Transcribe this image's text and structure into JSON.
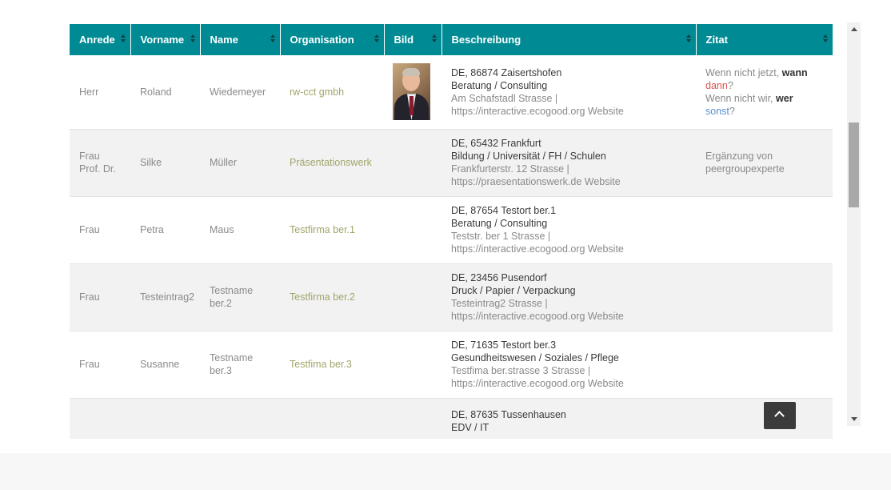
{
  "table": {
    "headers": [
      "Anrede",
      "Vorname",
      "Name",
      "Organisation",
      "Bild",
      "Beschreibung",
      "Zitat"
    ],
    "rows": [
      {
        "anrede": "Herr",
        "vorname": "Roland",
        "name": "Wiedemeyer",
        "organisation": "rw-cct gmbh",
        "has_photo": true,
        "desc_line1": "DE, 86874 Zaisertshofen",
        "desc_line2": "Beratung / Consulting",
        "desc_line3": "Am Schafstadl Strasse |",
        "desc_line4": "https://interactive.ecogood.org Website",
        "zitat": {
          "p1": "Wenn nicht jetzt, ",
          "p2": "wann",
          "p3": "dann",
          "p4": "?",
          "p5": "Wenn nicht wir, ",
          "p6": "wer",
          "p7": "sonst",
          "p8": "?"
        }
      },
      {
        "anrede_l1": "Frau",
        "anrede_l2": "Prof. Dr.",
        "vorname": "Silke",
        "name": "Müller",
        "organisation": "Präsentationswerk",
        "desc_line1": "DE, 65432 Frankfurt",
        "desc_line2": "Bildung / Universität / FH / Schulen",
        "desc_line3": "Frankfurterstr. 12 Strasse |",
        "desc_line4": "https://praesentationswerk.de Website",
        "zitat_l1": "Ergänzung von",
        "zitat_l2": "peergroupexperte"
      },
      {
        "anrede": "Frau",
        "vorname": "Petra",
        "name": "Maus",
        "organisation": "Testfirma ber.1",
        "desc_line1": "DE, 87654 Testort ber.1",
        "desc_line2": "Beratung / Consulting",
        "desc_line3": "Teststr. ber 1 Strasse |",
        "desc_line4": "https://interactive.ecogood.org Website"
      },
      {
        "anrede": "Frau",
        "vorname": "Testeintrag2",
        "name_l1": "Testname",
        "name_l2": "ber.2",
        "organisation": "Testfirma ber.2",
        "desc_line1": "DE, 23456 Pusendorf",
        "desc_line2": "Druck / Papier / Verpackung",
        "desc_line3": "Testeintrag2 Strasse |",
        "desc_line4": "https://interactive.ecogood.org Website"
      },
      {
        "anrede": "Frau",
        "vorname": "Susanne",
        "name_l1": "Testname",
        "name_l2": "ber.3",
        "organisation": "Testfima ber.3",
        "desc_line1": "DE, 71635 Testort ber.3",
        "desc_line2": "Gesundheitswesen / Soziales / Pflege",
        "desc_line3": "Testfima ber.strasse 3 Strasse |",
        "desc_line4": "https://interactive.ecogood.org Website"
      },
      {
        "desc_line1": "DE, 87635 Tussenhausen",
        "desc_line2": "EDV / IT"
      }
    ]
  },
  "icons": {
    "sort": "sort-icon",
    "back_to_top": "chevron-up-icon"
  }
}
